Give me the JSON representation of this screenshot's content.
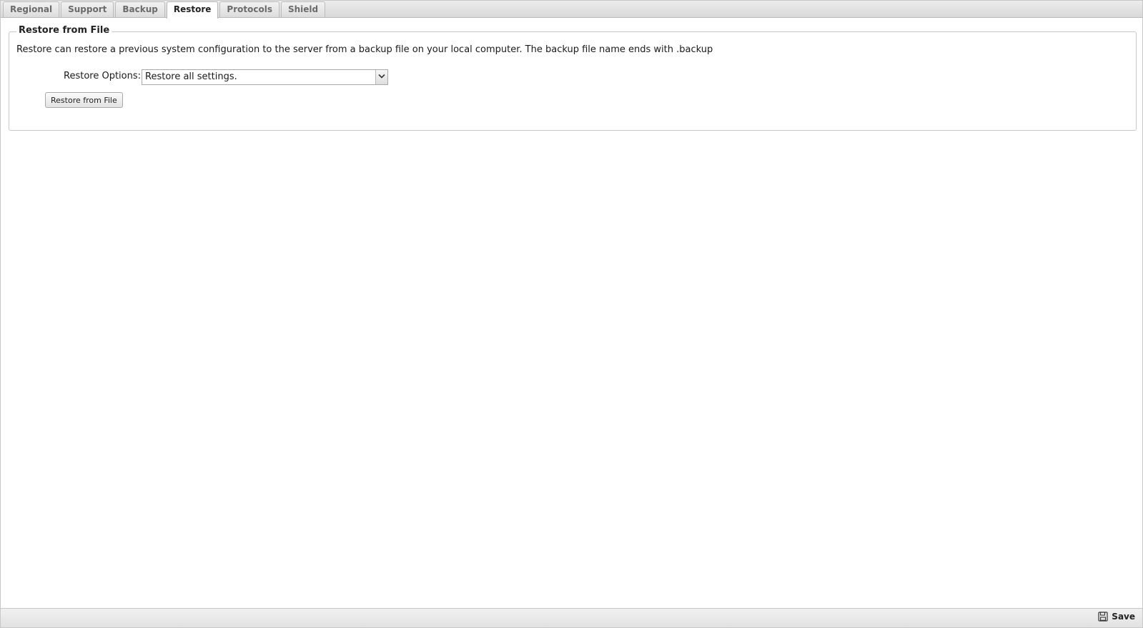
{
  "tabs": [
    {
      "label": "Regional",
      "active": false
    },
    {
      "label": "Support",
      "active": false
    },
    {
      "label": "Backup",
      "active": false
    },
    {
      "label": "Restore",
      "active": true
    },
    {
      "label": "Protocols",
      "active": false
    },
    {
      "label": "Shield",
      "active": false
    }
  ],
  "restore": {
    "legend": "Restore from File",
    "description": "Restore can restore a previous system configuration to the server from a backup file on your local computer. The backup file name ends with .backup",
    "options_label": "Restore Options:",
    "options_selected": "Restore all settings.",
    "button_label": "Restore from File"
  },
  "footer": {
    "save_label": "Save",
    "save_icon": "floppy-disk-icon"
  }
}
